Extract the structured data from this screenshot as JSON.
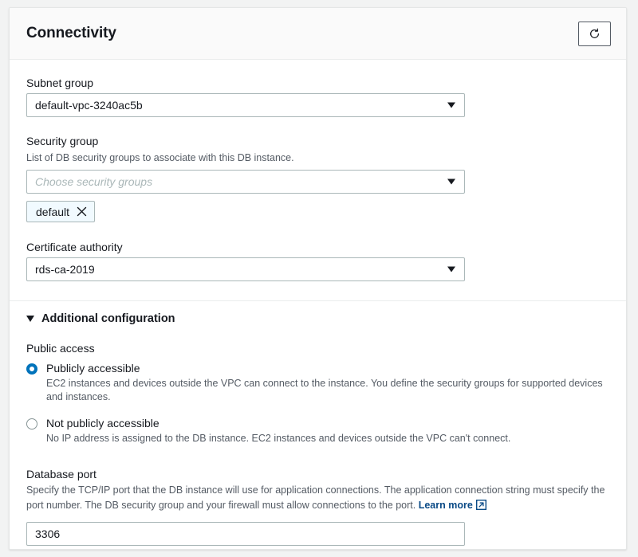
{
  "panel": {
    "title": "Connectivity",
    "refresh_button_label": "Refresh",
    "refresh_icon": "refresh-icon"
  },
  "subnet_group": {
    "label": "Subnet group",
    "value": "default-vpc-3240ac5b",
    "caret_icon": "chevron-down-icon"
  },
  "security_group": {
    "label": "Security group",
    "description": "List of DB security groups to associate with this DB instance.",
    "placeholder": "Choose security groups",
    "value": "",
    "caret_icon": "chevron-down-icon",
    "tokens": [
      {
        "label": "default",
        "dismiss_icon": "close-icon"
      }
    ]
  },
  "certificate_authority": {
    "label": "Certificate authority",
    "value": "rds-ca-2019",
    "caret_icon": "chevron-down-icon"
  },
  "additional_configuration": {
    "label": "Additional configuration",
    "expanded": true,
    "triangle_icon": "triangle-down-icon"
  },
  "public_access": {
    "label": "Public access",
    "options": [
      {
        "title": "Publicly accessible",
        "description": "EC2 instances and devices outside the VPC can connect to the instance. You define the security groups for supported devices and instances.",
        "selected": true
      },
      {
        "title": "Not publicly accessible",
        "description": "No IP address is assigned to the DB instance. EC2 instances and devices outside the VPC can't connect.",
        "selected": false
      }
    ]
  },
  "database_port": {
    "label": "Database port",
    "description": "Specify the TCP/IP port that the DB instance will use for application connections. The application connection string must specify the port number. The DB security group and your firewall must allow connections to the port.",
    "learn_more_label": "Learn more",
    "external_link_icon": "external-link-icon",
    "value": "3306"
  },
  "colors": {
    "accent": "#0073bb",
    "link": "#0a4a86",
    "token_background": "#f1faff",
    "text_primary": "#16191f",
    "text_secondary": "#545b64",
    "border": "#aab7b8",
    "page_background": "#f2f3f3"
  }
}
